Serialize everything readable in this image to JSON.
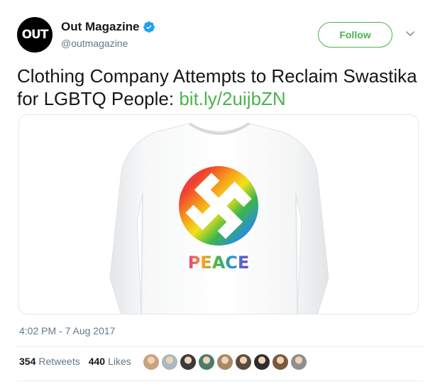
{
  "author": {
    "avatar_text": "OUT",
    "display_name": "Out Magazine",
    "handle": "@outmagazine",
    "verified_icon": "verified-badge-icon"
  },
  "follow_button": {
    "label": "Follow"
  },
  "tweet": {
    "text": "Clothing Company Attempts to Reclaim Swastika for LGBTQ People: ",
    "link": "bit.ly/2uijbZN"
  },
  "media": {
    "shirt_print_text": "PEACE"
  },
  "timestamp": "4:02 PM - 7 Aug 2017",
  "stats": {
    "retweets_count": "354",
    "retweets_label": "Retweets",
    "likes_count": "440",
    "likes_label": "Likes"
  },
  "colors": {
    "accent": "#4ab34c",
    "verified": "#1da1f2",
    "text_primary": "#14171a",
    "text_secondary": "#657786"
  },
  "liker_avatars": [
    {
      "color": "#c9a27a"
    },
    {
      "color": "#aab8c2"
    },
    {
      "color": "#3a3a3a"
    },
    {
      "color": "#4b7b6a"
    },
    {
      "color": "#a68966"
    },
    {
      "color": "#5a4b3c"
    },
    {
      "color": "#2d2d2d"
    },
    {
      "color": "#7a5a3d"
    },
    {
      "color": "#8e8e8e"
    }
  ]
}
